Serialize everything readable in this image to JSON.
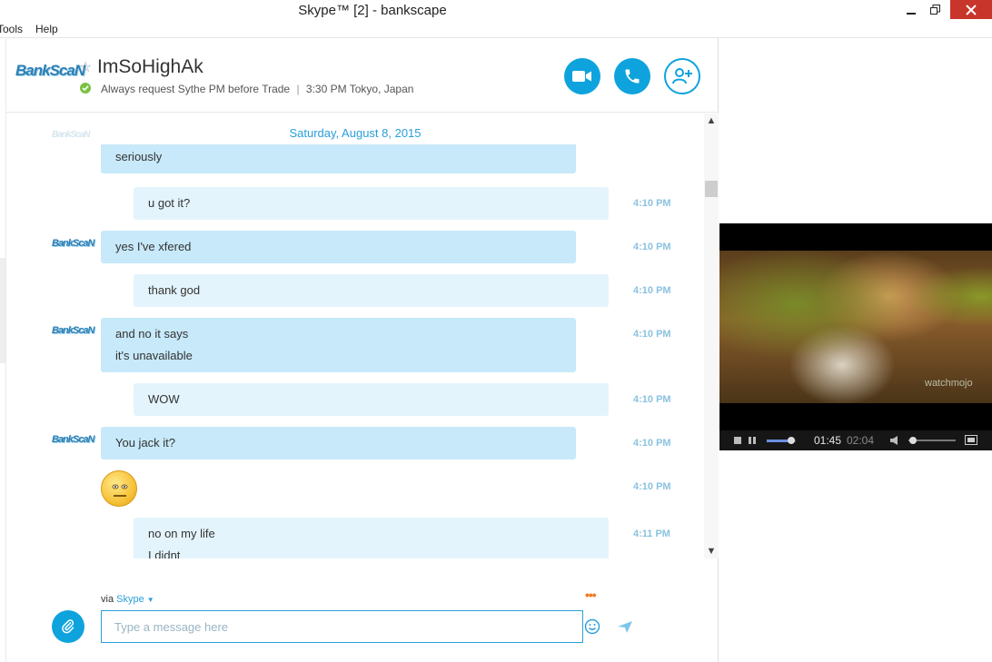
{
  "window": {
    "title": "Skype™ [2] - bankscape"
  },
  "menu": {
    "tools": "Tools",
    "help": "Help"
  },
  "contact": {
    "avatar_text": "BankScaN",
    "name": "ImSoHighAk",
    "mood": "Always request Sythe PM before Trade",
    "separator": "|",
    "local_time": "3:30 PM Tokyo, Japan",
    "status_color": "#7cc142"
  },
  "chat": {
    "date": "Saturday, August 8, 2015",
    "messages": [
      {
        "side": "theirs",
        "lines": [
          "seriously"
        ]
      },
      {
        "side": "mine",
        "lines": [
          "u got it?"
        ],
        "time": "4:10 PM"
      },
      {
        "side": "theirs",
        "lines": [
          "yes I've xfered"
        ],
        "time": "4:10 PM"
      },
      {
        "side": "mine",
        "lines": [
          "thank god"
        ],
        "time": "4:10 PM"
      },
      {
        "side": "theirs",
        "lines": [
          "and no it says",
          "it's unavailable"
        ],
        "time": "4:10 PM"
      },
      {
        "side": "mine",
        "lines": [
          "WOW"
        ],
        "time": "4:10 PM"
      },
      {
        "side": "theirs",
        "lines": [
          "You jack it?"
        ],
        "time": "4:10 PM"
      },
      {
        "side": "theirs",
        "emoticon": "straight-face-emoticon",
        "time": "4:10 PM"
      },
      {
        "side": "mine",
        "lines": [
          "no on my life",
          "I didnt"
        ],
        "time": "4:11 PM"
      }
    ]
  },
  "compose": {
    "via_label": "via",
    "via_service": "Skype",
    "placeholder": "Type a message here"
  },
  "video": {
    "elapsed": "01:45",
    "duration": "02:04",
    "progress": 0.84,
    "volume": 0.1,
    "watermark": "watchmojo"
  },
  "colors": {
    "accent": "#0ea3dc",
    "bubble_theirs": "#c7e9f9",
    "bubble_mine": "#e4f4fc"
  }
}
